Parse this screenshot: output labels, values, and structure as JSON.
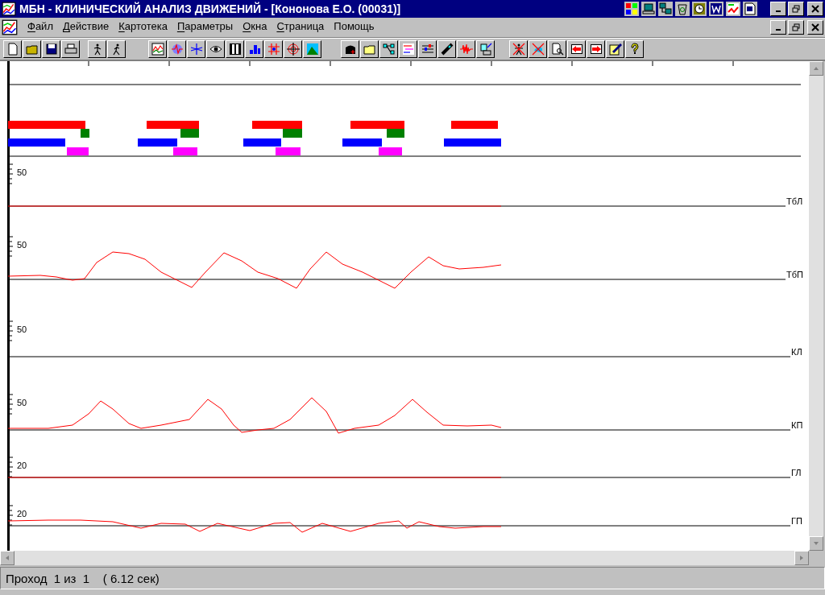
{
  "window": {
    "title": "МБН - КЛИНИЧЕСКИЙ АНАЛИЗ ДВИЖЕНИЙ - [Кононова Е.О. (00031)]"
  },
  "menu": [
    {
      "label": "Файл",
      "underline_first": true
    },
    {
      "label": "Действие",
      "underline_first": true
    },
    {
      "label": "Картотека",
      "underline_first": true
    },
    {
      "label": "Параметры",
      "underline_first": true
    },
    {
      "label": "Окна",
      "underline_first": true
    },
    {
      "label": "Страница",
      "underline_first": true
    },
    {
      "label": "Помощь",
      "underline_first": false
    }
  ],
  "channels": [
    {
      "label": "ТбЛ",
      "scale": "50"
    },
    {
      "label": "ТбП",
      "scale": "50"
    },
    {
      "label": "КЛ",
      "scale": "50"
    },
    {
      "label": "КП",
      "scale": "50"
    },
    {
      "label": "ГЛ",
      "scale": "20"
    },
    {
      "label": "ГП",
      "scale": "20"
    }
  ],
  "status_bar": {
    "text": "Проход  1 из  1    ( 6.12 сек)"
  }
}
